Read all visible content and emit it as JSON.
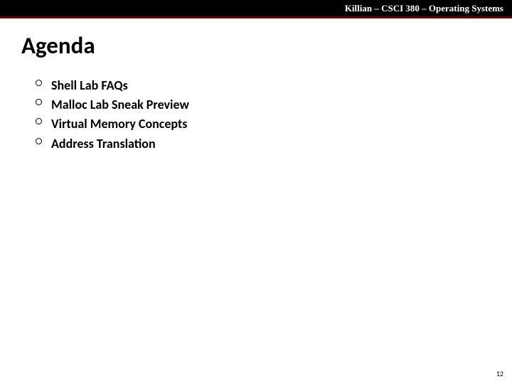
{
  "header": {
    "course_info": "Killian – CSCI 380 – Operating Systems"
  },
  "slide": {
    "title": "Agenda",
    "bullets": [
      "Shell Lab FAQs",
      "Malloc Lab Sneak Preview",
      "Virtual Memory Concepts",
      "Address Translation"
    ],
    "page_number": "12"
  }
}
